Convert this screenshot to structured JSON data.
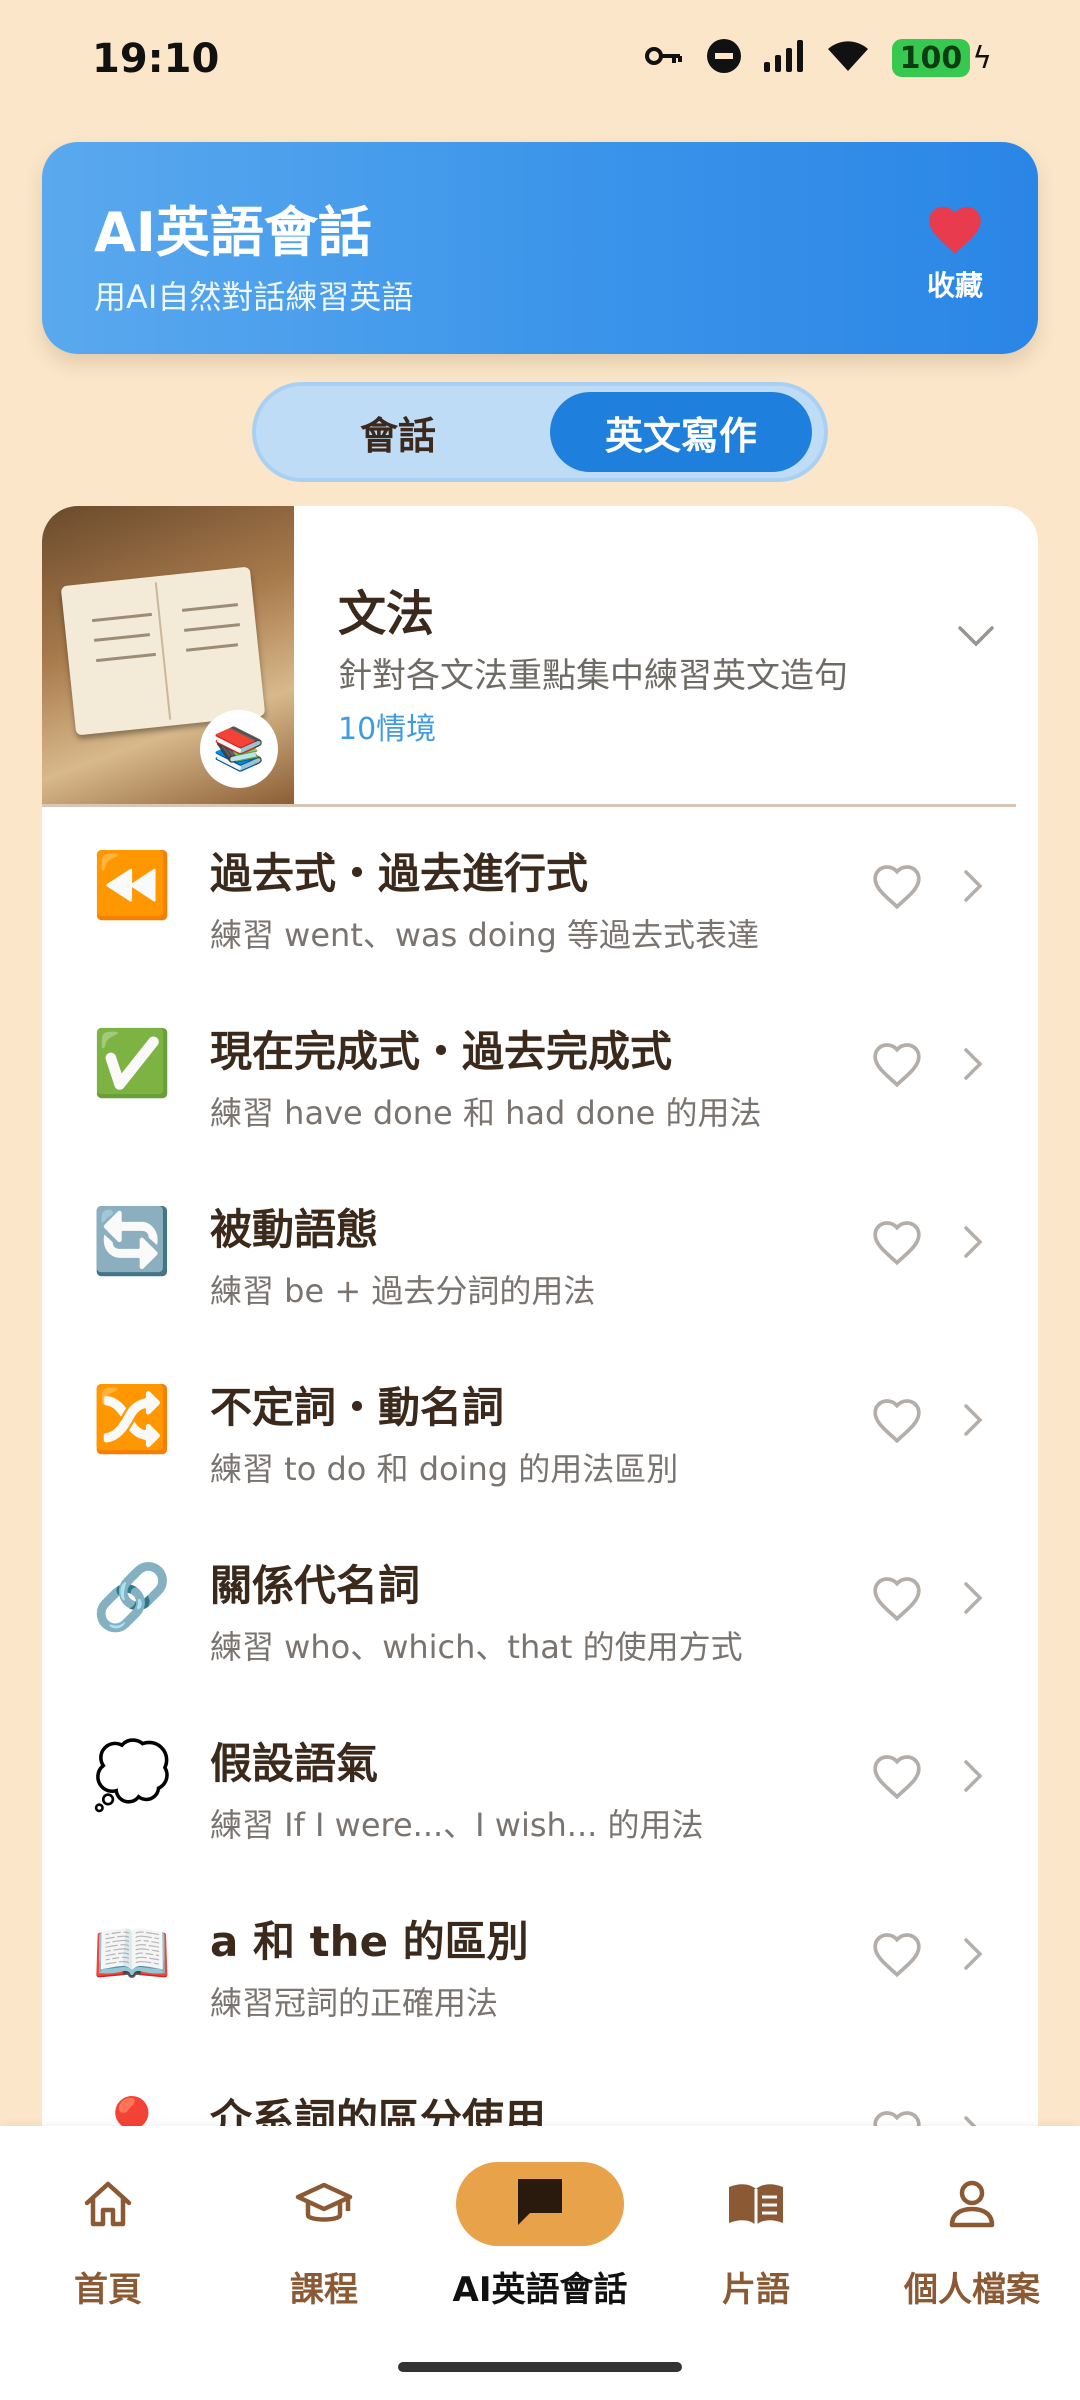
{
  "status_bar": {
    "time": "19:10",
    "battery": "100"
  },
  "header": {
    "title": "AI英語會話",
    "subtitle": "用AI自然對話練習英語",
    "favorite_label": "收藏"
  },
  "tabs": [
    {
      "label": "會話",
      "active": false
    },
    {
      "label": "英文寫作",
      "active": true
    }
  ],
  "category": {
    "title": "文法",
    "description": "針對各文法重點集中練習英文造句",
    "count": "10情境",
    "badge_icon": "books-icon"
  },
  "items": [
    {
      "icon": "⏪",
      "title": "過去式・過去進行式",
      "desc": "練習 went、was doing 等過去式表達"
    },
    {
      "icon": "✅",
      "title": "現在完成式・過去完成式",
      "desc": "練習 have done 和 had done 的用法"
    },
    {
      "icon": "🔄",
      "title": "被動語態",
      "desc": "練習 be + 過去分詞的用法"
    },
    {
      "icon": "🔀",
      "title": "不定詞・動名詞",
      "desc": "練習 to do 和 doing 的用法區別"
    },
    {
      "icon": "🔗",
      "title": "關係代名詞",
      "desc": "練習 who、which、that 的使用方式"
    },
    {
      "icon": "💭",
      "title": "假設語氣",
      "desc": "練習 If I were...、I wish... 的用法"
    },
    {
      "icon": "📖",
      "title": "a 和 the 的區別",
      "desc": "練習冠詞的正確用法"
    },
    {
      "icon": "📍",
      "title": "介系詞的區分使用",
      "desc": ""
    }
  ],
  "bottom_nav": [
    {
      "label": "首頁",
      "icon": "home-icon",
      "active": false
    },
    {
      "label": "課程",
      "icon": "graduation-cap-icon",
      "active": false
    },
    {
      "label": "AI英語會話",
      "icon": "chat-icon",
      "active": true
    },
    {
      "label": "片語",
      "icon": "book-icon",
      "active": false
    },
    {
      "label": "個人檔案",
      "icon": "person-icon",
      "active": false
    }
  ],
  "colors": {
    "background": "#fbe6c9",
    "header_start": "#5aa9ee",
    "header_end": "#2a86e6",
    "active_tab": "#1f7fdc",
    "nav_active": "#e8a24a",
    "nav_label": "#8b5a34"
  }
}
